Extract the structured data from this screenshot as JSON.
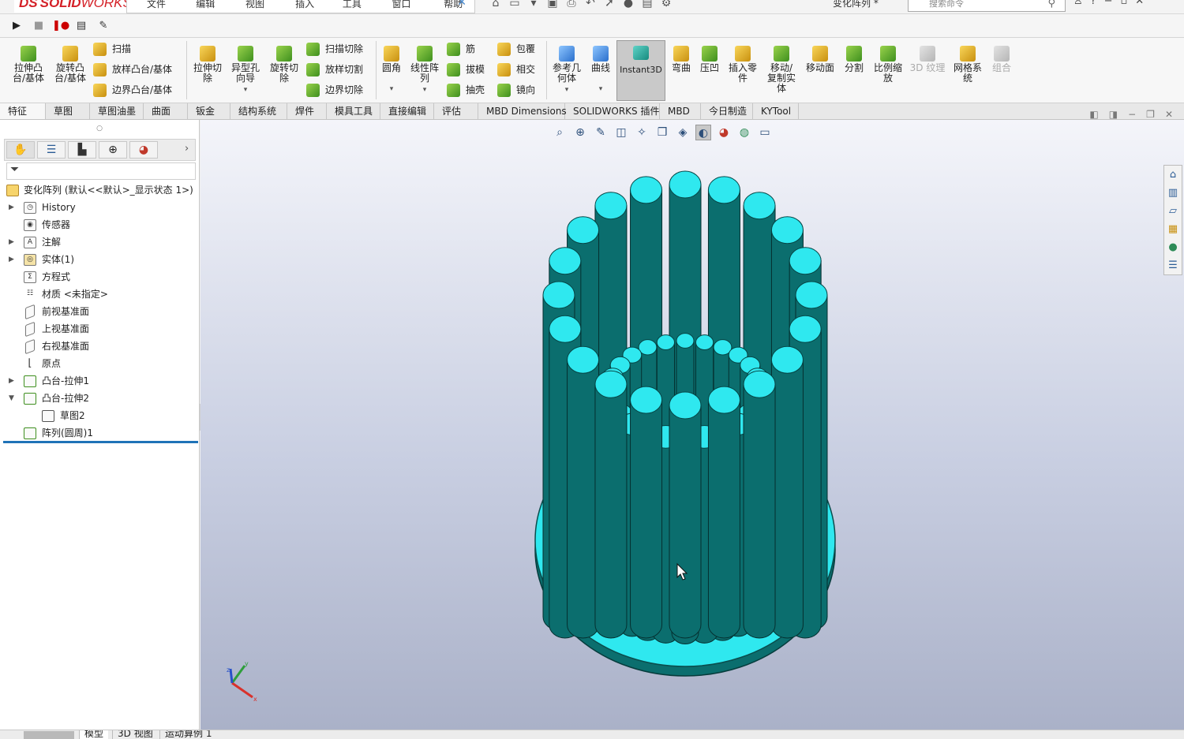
{
  "titlebar": {
    "logo_ds": "DS",
    "logo_solid": "SOLID",
    "logo_works": "WORKS",
    "menus": [
      "文件(F)",
      "编辑(E)",
      "视图(V)",
      "插入(I)",
      "工具(T)",
      "窗口(W)",
      "帮助(H)"
    ],
    "pin_icon": "pin-icon",
    "document_title": "变化阵列 *",
    "search_placeholder": "搜索命令",
    "window_controls": [
      "minimize-icon",
      "restore-icon",
      "close-icon"
    ]
  },
  "macro_bar": {
    "buttons": [
      "run-macro-icon",
      "stop-macro-icon",
      "record-pause-icon",
      "new-macro-icon",
      "edit-macro-icon"
    ]
  },
  "command_manager": {
    "big_buttons": [
      {
        "label": "拉伸凸\n台/基体"
      },
      {
        "label": "旋转凸\n台/基体"
      },
      {
        "label": "拉伸切\n除"
      },
      {
        "label": "异型孔\n向导"
      },
      {
        "label": "旋转切\n除"
      },
      {
        "label": "圆角"
      },
      {
        "label": "线性阵\n列"
      },
      {
        "label": "参考几\n何体"
      },
      {
        "label": "曲线"
      },
      {
        "label": "Instant3D"
      },
      {
        "label": "弯曲"
      },
      {
        "label": "压凹"
      },
      {
        "label": "插入零\n件"
      },
      {
        "label": "移动/\n复制实\n体"
      },
      {
        "label": "移动面"
      },
      {
        "label": "分割"
      },
      {
        "label": "比例缩\n放"
      },
      {
        "label": "3D 纹理"
      },
      {
        "label": "网格系\n统"
      },
      {
        "label": "组合"
      }
    ],
    "small_buttons": {
      "sweep": "扫描",
      "loft": "放样凸台/基体",
      "boundary": "边界凸台/基体",
      "sweep_cut": "扫描切除",
      "loft_cut": "放样切割",
      "boundary_cut": "边界切除",
      "rib": "筋",
      "draft": "拔模",
      "shell": "抽壳",
      "wrap": "包覆",
      "intersect": "相交",
      "mirror": "镜向"
    }
  },
  "tabs": [
    "特征",
    "草图",
    "草图油墨",
    "曲面",
    "钣金",
    "结构系统",
    "焊件",
    "模具工具",
    "直接编辑",
    "评估",
    "MBD Dimensions",
    "SOLIDWORKS 插件",
    "MBD",
    "今日制造",
    "KYTool"
  ],
  "active_tab": "特征",
  "feature_tree": {
    "root": "变化阵列  (默认<<默认>_显示状态 1>)",
    "items": [
      {
        "label": "History",
        "expandable": true,
        "icon": "history-folder-icon"
      },
      {
        "label": "传感器",
        "expandable": false,
        "icon": "sensor-icon"
      },
      {
        "label": "注解",
        "expandable": true,
        "icon": "annotation-icon"
      },
      {
        "label": "实体(1)",
        "expandable": true,
        "icon": "solid-bodies-icon"
      },
      {
        "label": "方程式",
        "expandable": false,
        "icon": "equations-icon"
      },
      {
        "label": "材质 <未指定>",
        "expandable": false,
        "icon": "material-icon"
      },
      {
        "label": "前视基准面",
        "expandable": false,
        "icon": "plane-icon"
      },
      {
        "label": "上视基准面",
        "expandable": false,
        "icon": "plane-icon"
      },
      {
        "label": "右视基准面",
        "expandable": false,
        "icon": "plane-icon"
      },
      {
        "label": "原点",
        "expandable": false,
        "icon": "origin-icon"
      },
      {
        "label": "凸台-拉伸1",
        "expandable": true,
        "icon": "extrude-icon"
      },
      {
        "label": "凸台-拉伸2",
        "expandable": true,
        "expanded": true,
        "icon": "extrude-icon"
      },
      {
        "label": "草图2",
        "child": true,
        "icon": "sketch-icon"
      },
      {
        "label": "阵列(圆周)1",
        "expandable": false,
        "icon": "circular-pattern-icon"
      }
    ]
  },
  "heads_up_toolbar": [
    "zoom-to-fit-icon",
    "zoom-area-icon",
    "previous-view-icon",
    "section-view-icon",
    "dynamic-annotation-icon",
    "view-orientation-icon",
    "display-style-icon",
    "hide-show-icon",
    "edit-appearance-icon",
    "apply-scene-icon",
    "view-settings-icon"
  ],
  "task_pane": [
    "home-icon",
    "design-library-icon",
    "file-explorer-icon",
    "view-palette-icon",
    "appearances-icon",
    "custom-properties-icon"
  ],
  "model": {
    "body_color": "#0b6e6e",
    "face_color": "#2fe8ef",
    "outer_ring_count": 20,
    "inner_ring_count": 24
  },
  "triad": {
    "x": "x",
    "y": "y",
    "z": "z"
  },
  "bottom_tabs": [
    "模型",
    "3D 视图",
    "运动算例 1"
  ],
  "active_bottom_tab": "模型",
  "colors": {
    "accent": "#1f73b7",
    "brand": "#d42027"
  }
}
